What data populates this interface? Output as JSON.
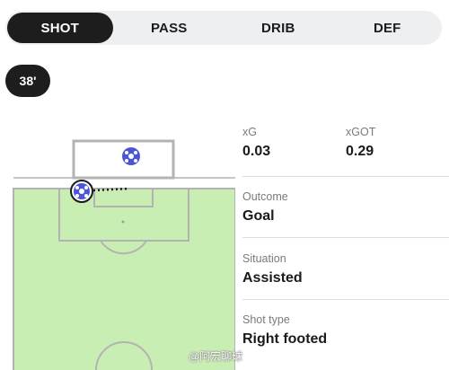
{
  "tabs": [
    {
      "label": "SHOT",
      "active": true
    },
    {
      "label": "PASS",
      "active": false
    },
    {
      "label": "DRIB",
      "active": false
    },
    {
      "label": "DEF",
      "active": false
    }
  ],
  "minute": "38'",
  "stats": {
    "xg_label": "xG",
    "xg_value": "0.03",
    "xgot_label": "xGOT",
    "xgot_value": "0.29",
    "outcome_label": "Outcome",
    "outcome_value": "Goal",
    "situation_label": "Situation",
    "situation_value": "Assisted",
    "shot_type_label": "Shot type",
    "shot_type_value": "Right footed"
  },
  "watermark": "@阿宏聊球",
  "colors": {
    "pitch": "#c9eeb4",
    "lines": "#b3b3b3",
    "ball": "#4a55d8",
    "active_tab": "#1d1d1d"
  }
}
